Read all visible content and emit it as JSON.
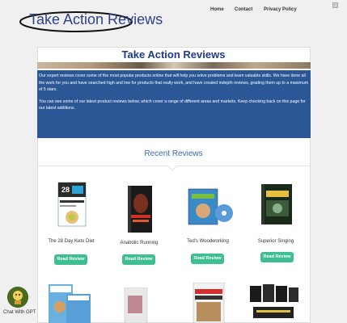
{
  "header": {
    "logo_text": "Take Action Reviews",
    "nav": [
      "Home",
      "Contact",
      "Privacy Policy"
    ]
  },
  "page": {
    "title": "Take Action Reviews",
    "intro_1": "Our expert reviews cover some of the most popular products online that will help you solve problems and learn valuable skills. We have done all the work for you and have searched high and low for products that really work, and have created indepth reviews, grading them up to a maximum of 5 stars.",
    "intro_2": "You can see some of our latest product reviews below, which cover a range of different areas and markets. Keep checking back on this page for our latest additions.",
    "recent_heading": "Recent Reviews"
  },
  "products": [
    {
      "name": "The 28 Day Keto Diet",
      "button": "Read Review"
    },
    {
      "name": "Anabolic Running",
      "button": "Read Review"
    },
    {
      "name": "Ted's Woodworking",
      "button": "Read Review"
    },
    {
      "name": "Superior Singing",
      "button": "Read Review"
    }
  ],
  "chat": {
    "label": "Chat With GPT"
  },
  "colors": {
    "brand_blue": "#2b5797",
    "title_blue": "#1f3a8f",
    "button_green": "#3fbf8f",
    "background": "#f0f0f0"
  }
}
